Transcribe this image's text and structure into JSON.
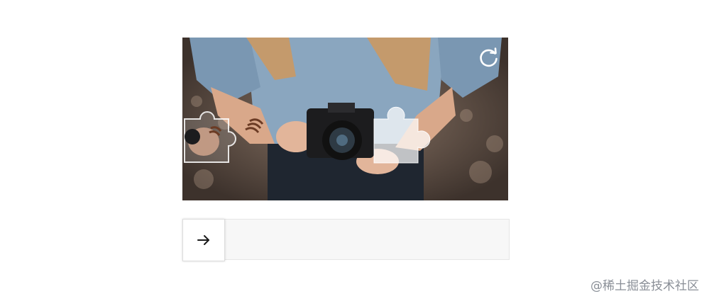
{
  "captcha": {
    "image_description_icon": "photo-scene",
    "refresh_icon": "refresh-icon",
    "puzzle_piece_icon": "puzzle-piece",
    "puzzle_target_icon": "puzzle-slot"
  },
  "slider": {
    "handle_icon": "arrow-right-icon",
    "progress": 0
  },
  "watermark": {
    "text": "@稀土掘金技术社区"
  },
  "colors": {
    "track_bg": "#f7f7f7",
    "track_border": "#e6e6e6",
    "handle_bg": "#ffffff"
  }
}
